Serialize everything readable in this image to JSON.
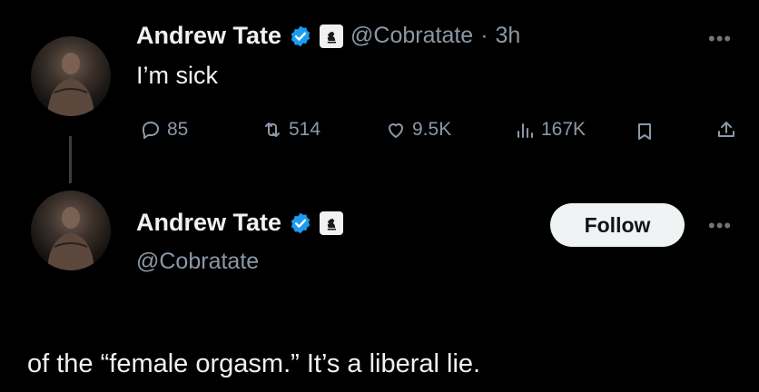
{
  "tweet": {
    "author_name": "Andrew Tate",
    "handle": "@Cobratate",
    "separator": "·",
    "time": "3h",
    "text": "I’m sick",
    "actions": {
      "replies": "85",
      "reposts": "514",
      "likes": "9.5K",
      "views": "167K"
    }
  },
  "profile": {
    "author_name": "Andrew Tate",
    "handle": "@Cobratate",
    "follow_label": "Follow"
  },
  "continuation": {
    "text": "of the “female orgasm.” It’s a liberal lie."
  },
  "colors": {
    "background": "#000000",
    "verified_blue": "#1d9bf0",
    "muted": "#8b98a5",
    "follow_bg": "#eff3f4"
  },
  "icons": {
    "reply": "reply-icon",
    "repost": "repost-icon",
    "like": "heart-icon",
    "views": "views-icon",
    "bookmark": "bookmark-icon",
    "share": "share-icon",
    "more": "more-icon",
    "verified": "verified-icon",
    "affiliate": "chess-knight-icon"
  }
}
